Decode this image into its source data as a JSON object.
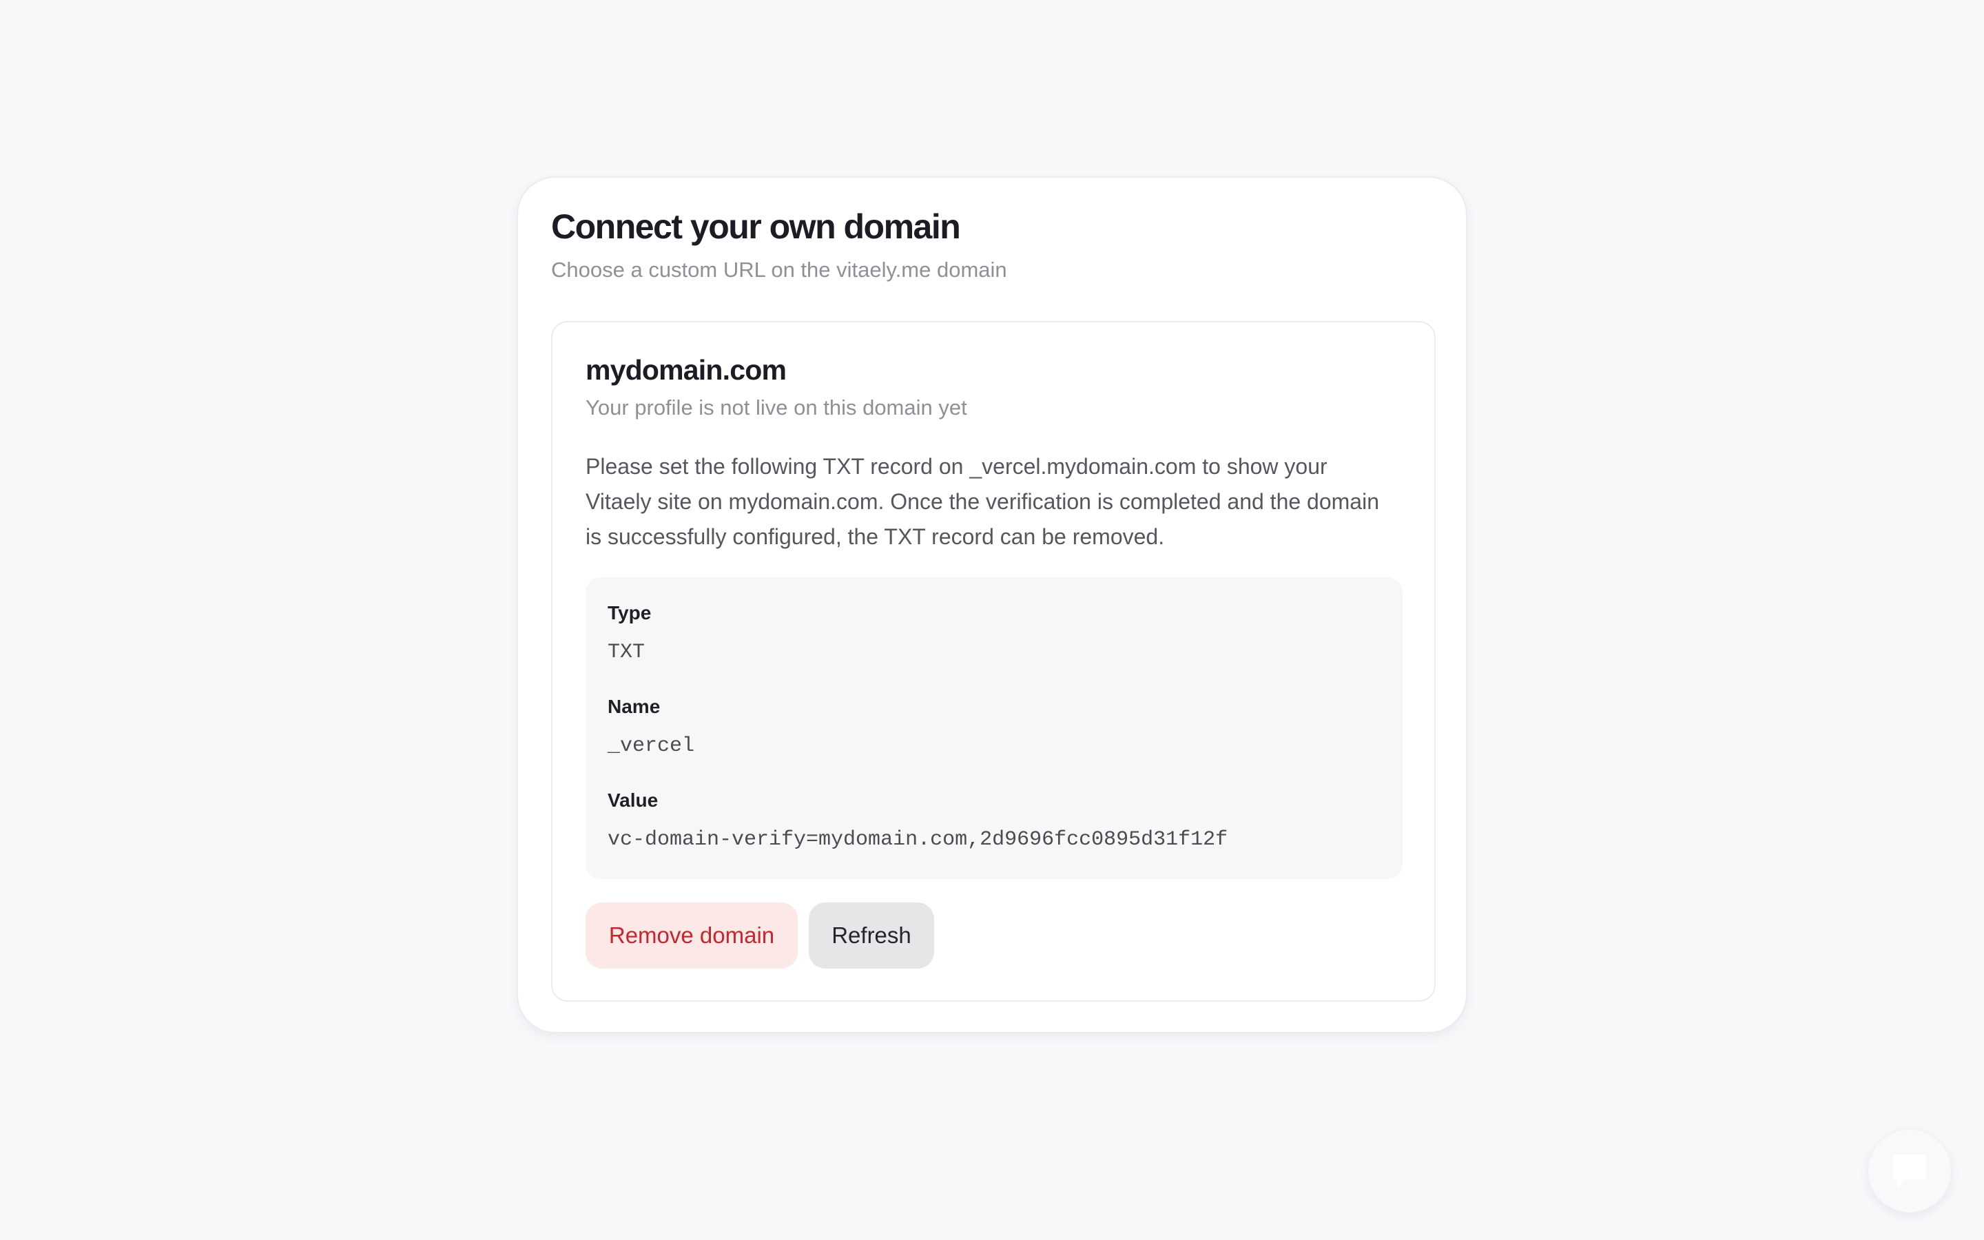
{
  "card": {
    "title": "Connect your own domain",
    "subtitle": "Choose a custom URL on the vitaely.me domain"
  },
  "domain": {
    "name": "mydomain.com",
    "status": "Your profile is not live on this domain yet",
    "instructions": "Please set the following TXT record on _vercel.mydomain.com to show your Vitaely site on mydomain.com. Once the verification is completed and the domain is successfully configured, the TXT record can be removed."
  },
  "record": {
    "type_label": "Type",
    "type_value": "TXT",
    "name_label": "Name",
    "name_value": "_vercel",
    "value_label": "Value",
    "value_value": "vc-domain-verify=mydomain.com,2d9696fcc0895d31f12f"
  },
  "actions": {
    "remove_label": "Remove domain",
    "refresh_label": "Refresh"
  },
  "chat": {
    "icon": "chat-bubble-icon"
  },
  "colors": {
    "background": "#f8f8fb",
    "danger_text": "#c8262c",
    "danger_bg": "#fde8e8",
    "neutral_bg": "#e6e6e8"
  }
}
